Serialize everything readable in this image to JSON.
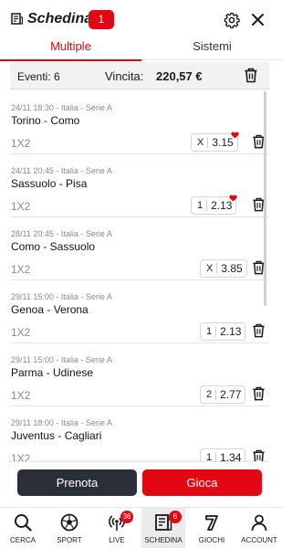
{
  "header": {
    "title": "Schedina",
    "count": "1"
  },
  "tabs": [
    {
      "label": "Multiple",
      "active": true
    },
    {
      "label": "Sistemi",
      "active": false
    }
  ],
  "summary": {
    "eventi": "Eventi: 6",
    "vincita_label": "Vincita:",
    "vincita_value": "220,57 €"
  },
  "bets": [
    {
      "meta": "24/11 18:30 - Italia - Serie A",
      "match": "Torino - Como",
      "market": "1X2",
      "selection": "X",
      "odd": "3.15",
      "favorite": true
    },
    {
      "meta": "24/11 20:45 - Italia - Serie A",
      "match": "Sassuolo - Pisa",
      "market": "1X2",
      "selection": "1",
      "odd": "2.13",
      "favorite": true
    },
    {
      "meta": "28/11 20:45 - Italia - Serie A",
      "match": "Como - Sassuolo",
      "market": "1X2",
      "selection": "X",
      "odd": "3.85",
      "favorite": false
    },
    {
      "meta": "29/11 15:00 - Italia - Serie A",
      "match": "Genoa - Verona",
      "market": "1X2",
      "selection": "1",
      "odd": "2.13",
      "favorite": false
    },
    {
      "meta": "29/11 15:00 - Italia - Serie A",
      "match": "Parma - Udinese",
      "market": "1X2",
      "selection": "2",
      "odd": "2.77",
      "favorite": false
    },
    {
      "meta": "29/11 18:00 - Italia - Serie A",
      "match": "Juventus - Cagliari",
      "market": "1X2",
      "selection": "1",
      "odd": "1.34",
      "favorite": false
    }
  ],
  "actions": {
    "prenota": "Prenota",
    "gioca": "Gioca"
  },
  "nav": [
    {
      "label": "CERCA",
      "icon": "search-icon"
    },
    {
      "label": "SPORT",
      "icon": "soccer-ball-icon"
    },
    {
      "label": "LIVE",
      "icon": "live-icon",
      "badge": "36"
    },
    {
      "label": "SCHEDINA",
      "icon": "betslip-icon",
      "badge": "6",
      "active": true
    },
    {
      "label": "GIOCHI",
      "icon": "seven-icon"
    },
    {
      "label": "ACCOUNT",
      "icon": "user-icon"
    }
  ],
  "colors": {
    "brand": "#e30613",
    "dark_button": "#2a2f38"
  }
}
